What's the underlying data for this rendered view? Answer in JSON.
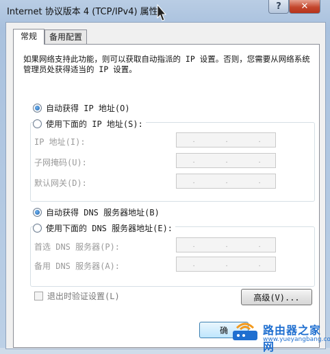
{
  "window": {
    "title": "Internet 协议版本 4 (TCP/IPv4) 属性",
    "help_label": "?",
    "close_label": "✕"
  },
  "tabs": [
    {
      "label": "常规",
      "active": true
    },
    {
      "label": "备用配置",
      "active": false
    }
  ],
  "description": "如果网络支持此功能，则可以获取自动指派的 IP 设置。否则，您需要从网络系统管理员处获得适当的 IP 设置。",
  "ip": {
    "auto_label": "自动获得 IP 地址(O)",
    "manual_label": "使用下面的 IP 地址(S):",
    "selected": "auto",
    "fields": [
      {
        "label": "IP 地址(I):",
        "value": ". . ."
      },
      {
        "label": "子网掩码(U):",
        "value": ". . ."
      },
      {
        "label": "默认网关(D):",
        "value": ". . ."
      }
    ]
  },
  "dns": {
    "auto_label": "自动获得 DNS 服务器地址(B)",
    "manual_label": "使用下面的 DNS 服务器地址(E):",
    "selected": "auto",
    "fields": [
      {
        "label": "首选 DNS 服务器(P):",
        "value": ". . ."
      },
      {
        "label": "备用 DNS 服务器(A):",
        "value": ". . ."
      }
    ]
  },
  "validate_label": "退出时验证设置(L)",
  "advanced_label": "高级(V)...",
  "ok_label": "确",
  "watermark": {
    "brand": "路由器之家网",
    "url": "www.yueyangbang.com"
  },
  "colors": {
    "accent": "#1d5fa8",
    "close": "#c4472d",
    "frame": "#b9cde4"
  }
}
